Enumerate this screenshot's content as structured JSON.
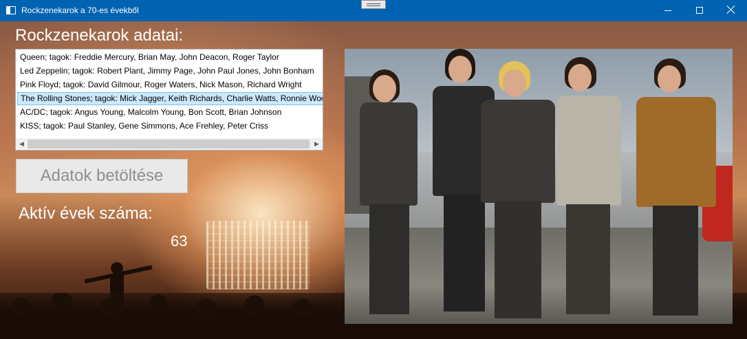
{
  "window": {
    "title": "Rockzenekarok a 70-es évekből"
  },
  "heading": "Rockzenekarok adatai:",
  "bands_list": {
    "items": [
      "Queen; tagok: Freddie Mercury, Brian May, John Deacon, Roger Taylor",
      "Led Zeppelin; tagok: Robert Plant, Jimmy Page, John Paul Jones, John Bonham",
      "Pink Floyd; tagok: David Gilmour, Roger Waters, Nick Mason, Richard Wright",
      "The Rolling Stones; tagok: Mick Jagger, Keith Richards, Charlie Watts, Ronnie Wood",
      "AC/DC; tagok: Angus Young, Malcolm Young, Bon Scott, Brian Johnson",
      "KISS; tagok: Paul Stanley, Gene Simmons, Ace Frehley, Peter Criss"
    ],
    "selected_index": 3
  },
  "load_button_label": "Adatok betöltése",
  "active_years_label": "Aktív évek száma:",
  "active_years_value": "63",
  "colors": {
    "titlebar": "#0063b1",
    "selection": "#cce8ff",
    "selection_border": "#26a0da"
  },
  "icons": {
    "app": "window-app-icon",
    "minimize": "minimize-icon",
    "maximize": "maximize-icon",
    "close": "close-icon",
    "scroll_left": "chevron-left-icon",
    "scroll_right": "chevron-right-icon"
  }
}
